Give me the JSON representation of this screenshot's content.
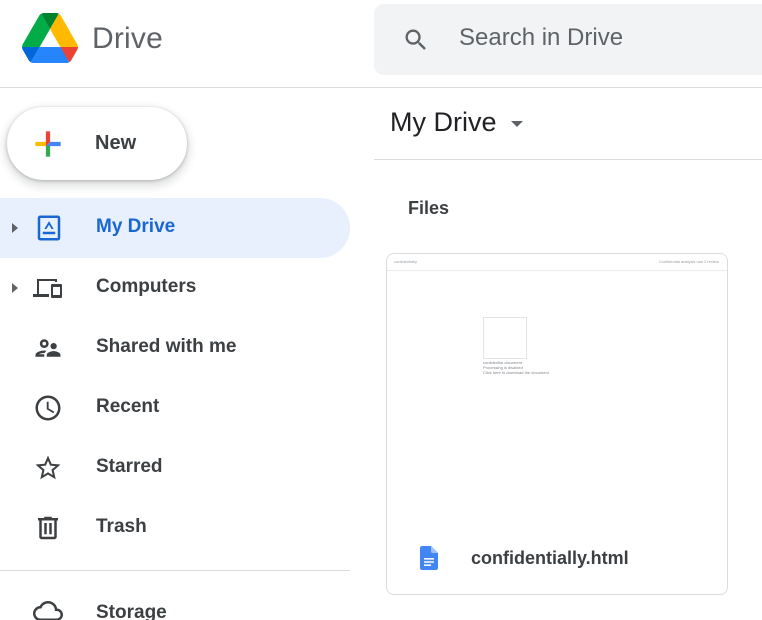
{
  "app": {
    "title": "Drive"
  },
  "search": {
    "placeholder": "Search in Drive"
  },
  "sidebar": {
    "new_label": "New",
    "items": [
      {
        "label": "My Drive",
        "icon": "my-drive-icon",
        "active": true,
        "expandable": true
      },
      {
        "label": "Computers",
        "icon": "computers-icon",
        "active": false,
        "expandable": true
      },
      {
        "label": "Shared with me",
        "icon": "shared-icon",
        "active": false,
        "expandable": false
      },
      {
        "label": "Recent",
        "icon": "clock-icon",
        "active": false,
        "expandable": false
      },
      {
        "label": "Starred",
        "icon": "star-icon",
        "active": false,
        "expandable": false
      },
      {
        "label": "Trash",
        "icon": "trash-icon",
        "active": false,
        "expandable": false
      },
      {
        "label": "Storage",
        "icon": "cloud-icon",
        "active": false,
        "expandable": false
      }
    ]
  },
  "main": {
    "breadcrumb": "My Drive",
    "section_title": "Files",
    "files": [
      {
        "name": "confidentially.html",
        "type_icon": "google-docs-icon",
        "thumbnail": {
          "header_left": "confidentially",
          "header_right": "Confidential analysis use 2 review",
          "lines": [
            "confidential document",
            "Processing is disabled",
            "Click here to download the document"
          ]
        }
      }
    ]
  },
  "colors": {
    "accent": "#1967d2",
    "active_bg": "#e8f0fe",
    "doc_blue": "#4285f4",
    "search_bg": "#f1f3f4"
  }
}
